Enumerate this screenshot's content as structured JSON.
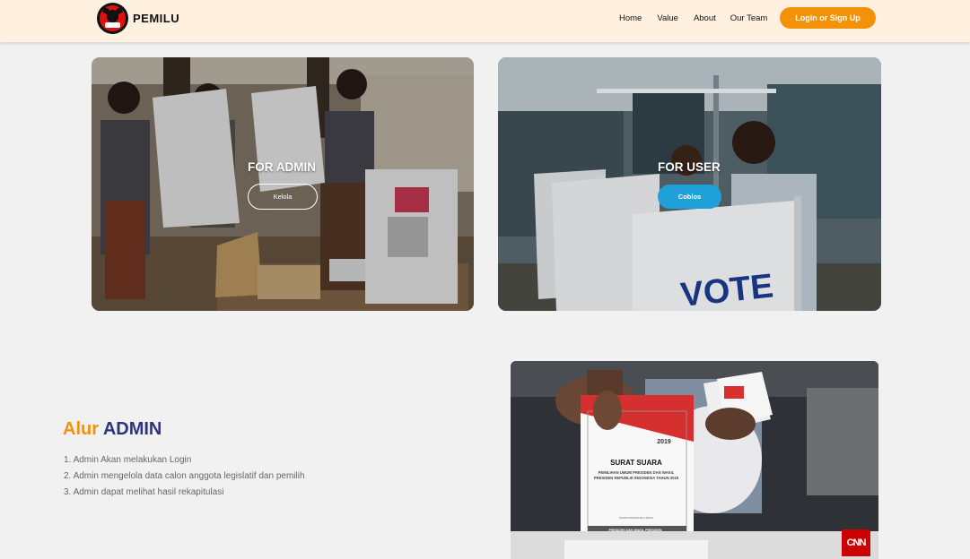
{
  "navbar": {
    "brand": "PEMILU",
    "links": [
      "Home",
      "Value",
      "About",
      "Our Team"
    ],
    "login_label": "Login or Sign Up",
    "accent_color": "#f39208"
  },
  "cards": {
    "admin": {
      "title": "FOR ADMIN",
      "button": "Kelola"
    },
    "user": {
      "title": "FOR USER",
      "button": "Coblos",
      "booth_text": "VOTE"
    }
  },
  "alur": {
    "title_part1": "Alur",
    "title_part2": "ADMIN",
    "steps": [
      "1. Admin Akan melakukan Login",
      "2. Admin mengelola data calon anggota legislatif dan pemilih",
      "3. Admin dapat melihat hasil rekapitulasi"
    ]
  },
  "ballot": {
    "title": "SURAT SUARA",
    "subtitle": "PEMILIHAN UMUM PRESIDEN DAN WAKIL PRESIDEN REPUBLIK INDONESIA TAHUN 2019",
    "year": "2019",
    "authority": "KOMISI PEMILIHAN UMUM",
    "footer": "PRESIDEN DAN WAKIL PRESIDEN",
    "watermark": "CNN"
  }
}
